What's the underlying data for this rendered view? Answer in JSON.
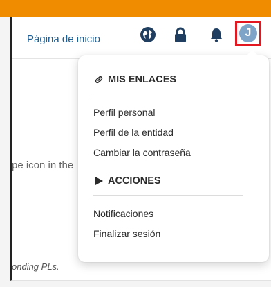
{
  "header": {
    "home_link": "Página de inicio",
    "avatar_initial": "J",
    "icons": [
      "globe-icon",
      "lock-icon",
      "bell-icon"
    ]
  },
  "background": {
    "text_line1": "pe icon in the",
    "text_line2": "onding PLs."
  },
  "dropdown": {
    "links_section": {
      "title": "MIS ENLACES",
      "icon": "link-icon",
      "items": [
        "Perfil personal",
        "Perfil de la entidad",
        "Cambiar la contraseña"
      ]
    },
    "actions_section": {
      "title": "ACCIONES",
      "icon": "play-icon",
      "items": [
        "Notificaciones",
        "Finalizar sesión"
      ]
    }
  },
  "colors": {
    "top_strip": "#f08c00",
    "link": "#1c5f96",
    "avatar_bg": "#7ea4c7",
    "highlight_border": "#e3171f",
    "icon": "#1f3e60"
  }
}
